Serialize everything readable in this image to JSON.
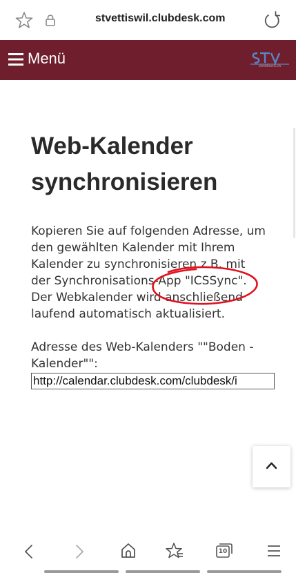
{
  "browser": {
    "url": "stvettiswil.clubdesk.com"
  },
  "menubar": {
    "menu_label": "Menü",
    "logo_text": "stvettiswil.ch",
    "color": "#6e1e2c"
  },
  "page": {
    "title_line1": "Web-Kalender",
    "title_line2": "synchronisieren",
    "para_lines": [
      "Kopieren Sie auf folgenden Adresse, um",
      "den gewählten Kalender mit Ihrem",
      "Kalender zu synchronisieren z.B. mit",
      "der Synchronisations-App \"ICSSync\".",
      "Der Webkalender wird anschließend",
      "laufend automatisch aktualisiert."
    ],
    "address_label_line1": "Adresse des Web-Kalenders \"\"Boden -",
    "address_label_line2": "Kalender\"\":",
    "calendar_url": "http://calendar.clubdesk.com/clubdesk/i"
  },
  "annotation_color": "#e0101e",
  "bottom_nav": {
    "tabs_count": "10"
  }
}
